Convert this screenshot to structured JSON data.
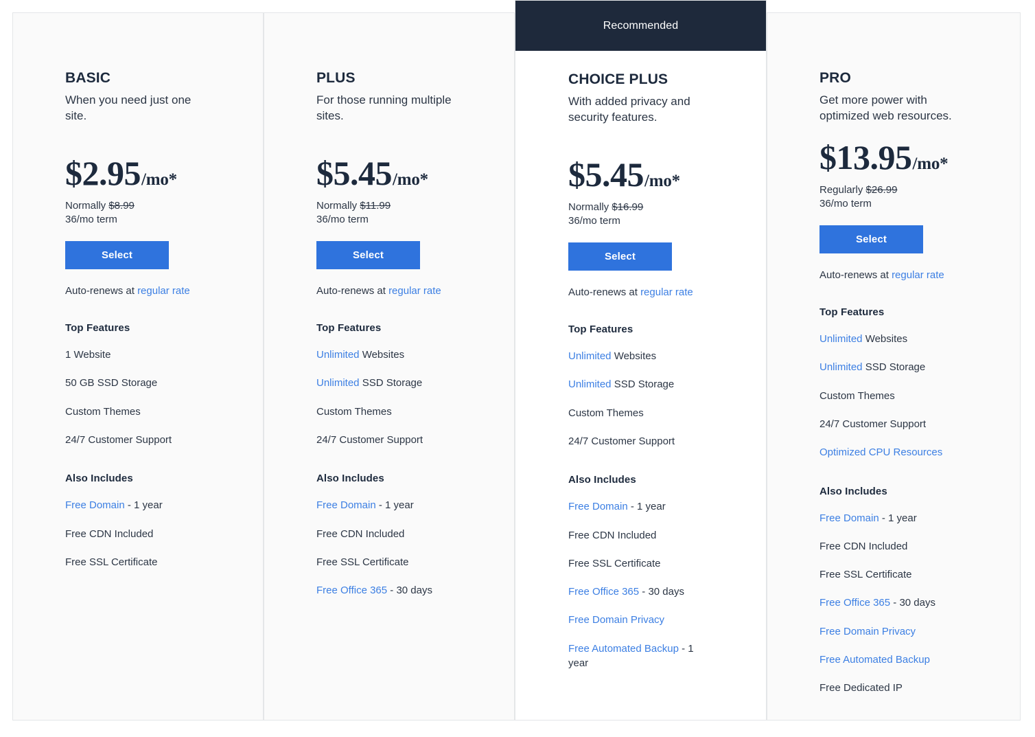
{
  "common": {
    "select_label": "Select",
    "autorenew_prefix": "Auto-renews at ",
    "autorenew_link": "regular rate",
    "top_features_label": "Top Features",
    "also_includes_label": "Also Includes",
    "recommended_label": "Recommended",
    "term": "36/mo term",
    "accent_blue": "#2f73dd",
    "link_blue": "#3c7fe3",
    "dark_navy": "#1e293b"
  },
  "plans": [
    {
      "name": "BASIC",
      "tagline": "When you need just one site.",
      "price_amount": "$2.95",
      "price_per": "/mo*",
      "normally_prefix": "Normally ",
      "normally_price": "$8.99",
      "term": "36/mo term",
      "recommended": false,
      "top_features": [
        {
          "highlight": "",
          "text": "1 Website"
        },
        {
          "highlight": "",
          "text": "50 GB SSD Storage"
        },
        {
          "highlight": "",
          "text": "Custom Themes"
        },
        {
          "highlight": "",
          "text": "24/7 Customer Support"
        }
      ],
      "also_includes": [
        {
          "highlight": "Free Domain",
          "text": " - 1 year"
        },
        {
          "highlight": "",
          "text": "Free CDN Included"
        },
        {
          "highlight": "",
          "text": "Free SSL Certificate"
        }
      ]
    },
    {
      "name": "PLUS",
      "tagline": "For those running multiple sites.",
      "price_amount": "$5.45",
      "price_per": "/mo*",
      "normally_prefix": "Normally ",
      "normally_price": "$11.99",
      "term": "36/mo term",
      "recommended": false,
      "top_features": [
        {
          "highlight": "Unlimited",
          "text": " Websites"
        },
        {
          "highlight": "Unlimited",
          "text": " SSD Storage"
        },
        {
          "highlight": "",
          "text": "Custom Themes"
        },
        {
          "highlight": "",
          "text": "24/7 Customer Support"
        }
      ],
      "also_includes": [
        {
          "highlight": "Free Domain",
          "text": " - 1 year"
        },
        {
          "highlight": "",
          "text": "Free CDN Included"
        },
        {
          "highlight": "",
          "text": "Free SSL Certificate"
        },
        {
          "highlight": "Free Office 365",
          "text": " - 30 days"
        }
      ]
    },
    {
      "name": "CHOICE PLUS",
      "tagline": "With added privacy and security features.",
      "price_amount": "$5.45",
      "price_per": "/mo*",
      "normally_prefix": "Normally ",
      "normally_price": "$16.99",
      "term": "36/mo term",
      "recommended": true,
      "top_features": [
        {
          "highlight": "Unlimited",
          "text": " Websites"
        },
        {
          "highlight": "Unlimited",
          "text": " SSD Storage"
        },
        {
          "highlight": "",
          "text": "Custom Themes"
        },
        {
          "highlight": "",
          "text": "24/7 Customer Support"
        }
      ],
      "also_includes": [
        {
          "highlight": "Free Domain",
          "text": " - 1 year"
        },
        {
          "highlight": "",
          "text": "Free CDN Included"
        },
        {
          "highlight": "",
          "text": "Free SSL Certificate"
        },
        {
          "highlight": "Free Office 365",
          "text": " - 30 days"
        },
        {
          "highlight": "Free Domain Privacy",
          "text": ""
        },
        {
          "highlight": "Free Automated Backup",
          "text": " - 1 year"
        }
      ]
    },
    {
      "name": "PRO",
      "tagline": "Get more power with optimized web resources.",
      "price_amount": "$13.95",
      "price_per": "/mo*",
      "normally_prefix": "Regularly ",
      "normally_price": "$26.99",
      "term": "36/mo term",
      "recommended": false,
      "top_features": [
        {
          "highlight": "Unlimited",
          "text": " Websites"
        },
        {
          "highlight": "Unlimited",
          "text": " SSD Storage"
        },
        {
          "highlight": "",
          "text": "Custom Themes"
        },
        {
          "highlight": "",
          "text": "24/7 Customer Support"
        },
        {
          "highlight": "Optimized CPU Resources",
          "text": ""
        }
      ],
      "also_includes": [
        {
          "highlight": "Free Domain",
          "text": " - 1 year"
        },
        {
          "highlight": "",
          "text": "Free CDN Included"
        },
        {
          "highlight": "",
          "text": "Free SSL Certificate"
        },
        {
          "highlight": "Free Office 365",
          "text": " - 30 days"
        },
        {
          "highlight": "Free Domain Privacy",
          "text": ""
        },
        {
          "highlight": "Free Automated Backup",
          "text": ""
        },
        {
          "highlight": "",
          "text": "Free Dedicated IP"
        }
      ]
    }
  ]
}
